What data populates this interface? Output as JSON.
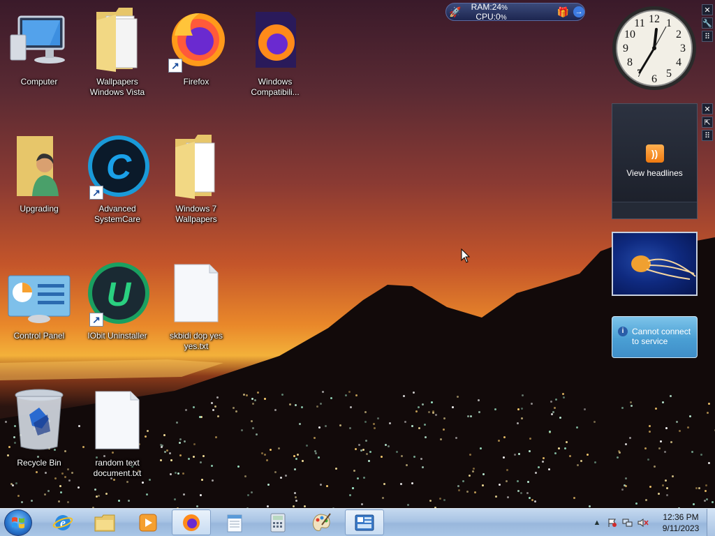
{
  "desktop": {
    "icons": [
      {
        "name": "computer",
        "label": "Computer"
      },
      {
        "name": "wallpapers-vista",
        "label": "Wallpapers Windows Vista"
      },
      {
        "name": "firefox",
        "label": "Firefox"
      },
      {
        "name": "windows-compat",
        "label": "Windows Compatibili..."
      },
      {
        "name": "upgrading",
        "label": "Upgrading"
      },
      {
        "name": "advanced-systemcare",
        "label": "Advanced SystemCare"
      },
      {
        "name": "windows7-wallpapers",
        "label": "Windows 7 Wallpapers"
      },
      {
        "name": "control-panel",
        "label": "Control Panel"
      },
      {
        "name": "iobit-uninstaller",
        "label": "IObit Uninstaller"
      },
      {
        "name": "skbidi",
        "label": "skbidi dop yes yes.txt"
      },
      {
        "name": "recycle-bin",
        "label": "Recycle Bin"
      },
      {
        "name": "random-text",
        "label": "random text document.txt"
      }
    ]
  },
  "gadgets": {
    "monitor": {
      "ram_label": "RAM:",
      "ram_value": "24",
      "cpu_label": "CPU:",
      "cpu_value": "0",
      "unit": "%"
    },
    "feed": {
      "title": "View headlines"
    },
    "weather": {
      "message": "Cannot connect to service"
    }
  },
  "taskbar": {
    "time": "12:36 PM",
    "date": "9/11/2023"
  },
  "colors": {
    "taskbar": "#a9c4e4",
    "gadget_dark": "#1a1e28",
    "weather": "#4a9fd4",
    "accent_orange": "#f07a10"
  }
}
